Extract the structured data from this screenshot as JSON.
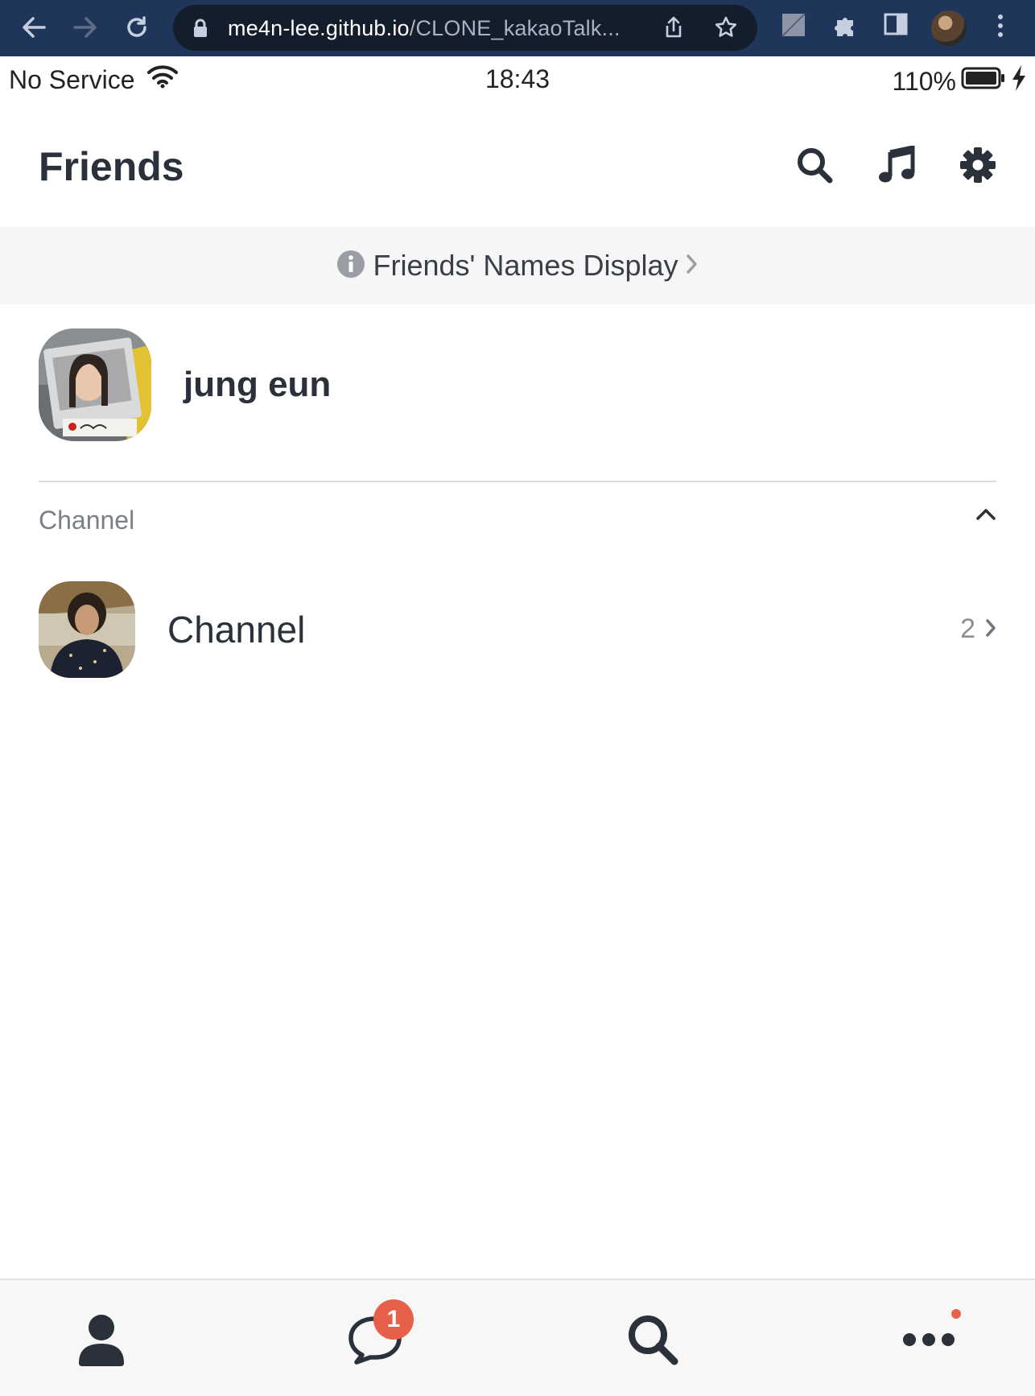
{
  "browser": {
    "url_host": "me4n-lee.github.io",
    "url_path": "/CLONE_kakaoTalk..."
  },
  "status_bar": {
    "carrier": "No Service",
    "time": "18:43",
    "battery": "110%"
  },
  "header": {
    "title": "Friends"
  },
  "banner": {
    "text": "Friends' Names Display"
  },
  "profile": {
    "name": "jung eun"
  },
  "channel_section": {
    "title": "Channel",
    "items": [
      {
        "name": "Channel",
        "count": "2"
      }
    ]
  },
  "tab_bar": {
    "chats_badge": "1"
  },
  "colors": {
    "accent_red": "#e7604a",
    "text_dark": "#2b313a",
    "chrome_bg": "#1f3559"
  }
}
